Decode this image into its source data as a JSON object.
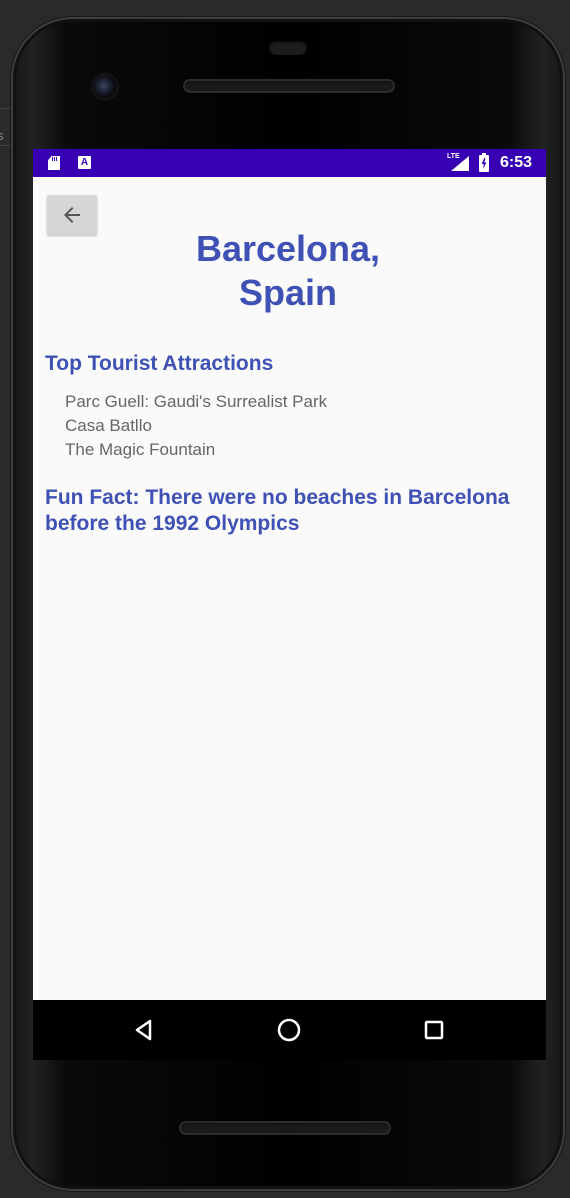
{
  "host": {
    "side_fragment": "s"
  },
  "status_bar": {
    "time": "6:53",
    "network": "LTE",
    "icons": [
      "sd-card-icon",
      "a-icon",
      "signal-icon",
      "battery-charging-icon"
    ],
    "left_badge": "A",
    "background_color": "#3700b3"
  },
  "app": {
    "back_icon": "arrow-left-icon",
    "title": "Barcelona,\nSpain",
    "attractions_heading": "Top Tourist Attractions",
    "attractions": [
      "Parc Guell: Gaudi's Surrealist Park",
      "Casa Batllo",
      "The Magic Fountain"
    ],
    "fun_fact": "Fun Fact: There were no beaches in Barcelona before the 1992 Olympics",
    "accent_color": "#3f51b5",
    "text_color": "#666666"
  },
  "navigation": {
    "back": "back-triangle-icon",
    "home": "home-circle-icon",
    "recents": "recents-square-icon"
  }
}
